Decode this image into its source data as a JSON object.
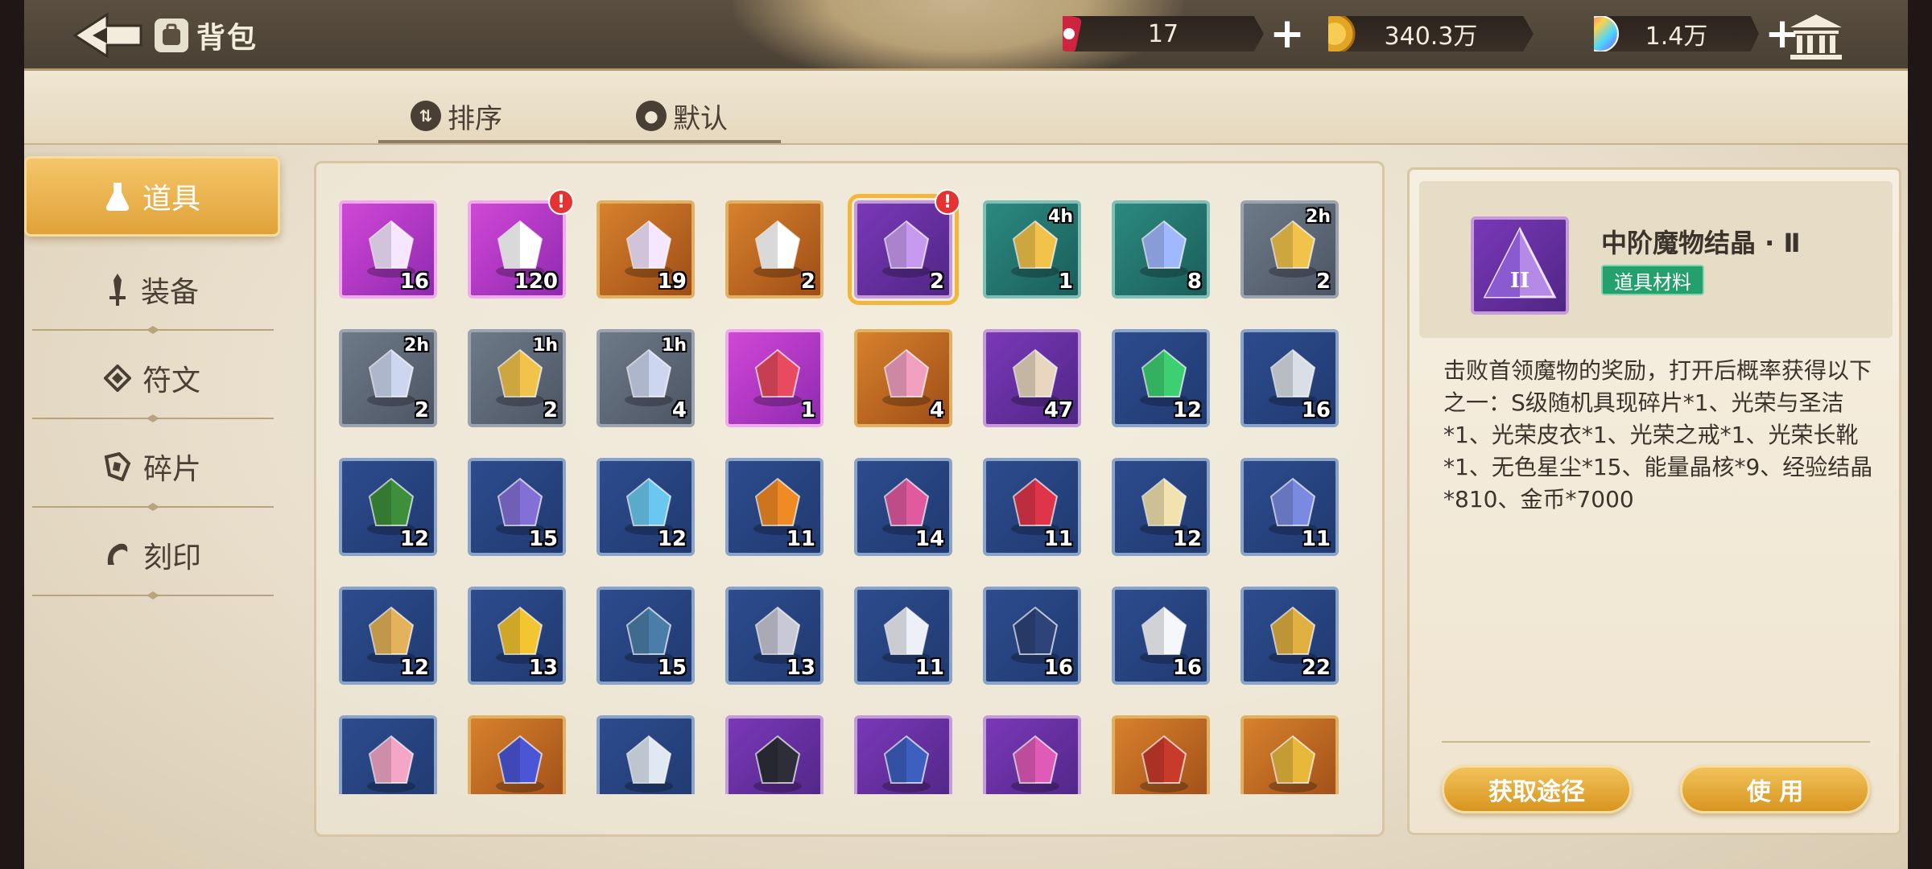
{
  "header": {
    "title": "背包",
    "currencies": [
      {
        "name": "stamina",
        "value": "17",
        "icon": "can-icon",
        "has_plus": true
      },
      {
        "name": "gold",
        "value": "340.3万",
        "icon": "gold-coin-icon",
        "has_plus": false
      },
      {
        "name": "gem",
        "value": "1.4万",
        "icon": "rainbow-gem-icon",
        "has_plus": true
      }
    ]
  },
  "sort": {
    "sort_label": "排序",
    "filter_label": "默认"
  },
  "categories": [
    {
      "label": "道具",
      "icon": "flask-icon",
      "active": true
    },
    {
      "label": "装备",
      "icon": "sword-icon",
      "active": false
    },
    {
      "label": "符文",
      "icon": "rune-icon",
      "active": false
    },
    {
      "label": "碎片",
      "icon": "shard-icon",
      "active": false
    },
    {
      "label": "刻印",
      "icon": "seal-icon",
      "active": false
    }
  ],
  "items": [
    {
      "icon": "mystery-card-icon",
      "rarity": "pink",
      "qty": "16"
    },
    {
      "icon": "character-card-icon",
      "rarity": "pink",
      "qty": "120",
      "alert": true
    },
    {
      "icon": "mystery-card-icon",
      "rarity": "orange",
      "qty": "19"
    },
    {
      "icon": "character-card-icon",
      "rarity": "orange",
      "qty": "2"
    },
    {
      "icon": "purple-crystal-icon",
      "rarity": "purple",
      "qty": "2",
      "alert": true,
      "selected": true
    },
    {
      "icon": "hourglass-coins-icon",
      "rarity": "teal",
      "qty": "1",
      "timer": "4h"
    },
    {
      "icon": "crystal-bowl-icon",
      "rarity": "teal",
      "qty": "8"
    },
    {
      "icon": "hourglass-coins-icon",
      "rarity": "gray",
      "qty": "2",
      "timer": "2h"
    },
    {
      "icon": "hourglass-crystals-icon",
      "rarity": "gray",
      "qty": "2",
      "timer": "2h"
    },
    {
      "icon": "hourglass-coins-icon",
      "rarity": "gray",
      "qty": "2",
      "timer": "1h"
    },
    {
      "icon": "hourglass-crystals-icon",
      "rarity": "gray",
      "qty": "4",
      "timer": "1h"
    },
    {
      "icon": "flower-bouquet-icon",
      "rarity": "pink",
      "qty": "1"
    },
    {
      "icon": "gift-box-icon",
      "rarity": "orange",
      "qty": "4"
    },
    {
      "icon": "robot-pet-icon",
      "rarity": "purple",
      "qty": "47"
    },
    {
      "icon": "green-crystal-icon",
      "rarity": "blue",
      "qty": "12"
    },
    {
      "icon": "white-stone-icon",
      "rarity": "blue",
      "qty": "16"
    },
    {
      "icon": "leaf-icon",
      "rarity": "blue",
      "qty": "12"
    },
    {
      "icon": "purple-rock-icon",
      "rarity": "blue",
      "qty": "15"
    },
    {
      "icon": "water-bowl-icon",
      "rarity": "blue",
      "qty": "12"
    },
    {
      "icon": "orange-potion-icon",
      "rarity": "blue",
      "qty": "11"
    },
    {
      "icon": "pink-potion-icon",
      "rarity": "blue",
      "qty": "14"
    },
    {
      "icon": "red-potion-icon",
      "rarity": "blue",
      "qty": "11"
    },
    {
      "icon": "seed-pile-icon",
      "rarity": "blue",
      "qty": "12"
    },
    {
      "icon": "blue-cloth-icon",
      "rarity": "blue",
      "qty": "11"
    },
    {
      "icon": "potatoes-icon",
      "rarity": "blue",
      "qty": "12"
    },
    {
      "icon": "golden-apple-icon",
      "rarity": "blue",
      "qty": "13"
    },
    {
      "icon": "umbrella-icon",
      "rarity": "blue",
      "qty": "15"
    },
    {
      "icon": "lighter-icon",
      "rarity": "blue",
      "qty": "13"
    },
    {
      "icon": "open-book-icon",
      "rarity": "blue",
      "qty": "11"
    },
    {
      "icon": "closed-book-icon",
      "rarity": "blue",
      "qty": "16"
    },
    {
      "icon": "milk-carton-icon",
      "rarity": "blue",
      "qty": "16"
    },
    {
      "icon": "medal-icon",
      "rarity": "blue",
      "qty": "22"
    },
    {
      "icon": "pink-cushion-icon",
      "rarity": "blue",
      "qty": ""
    },
    {
      "icon": "blue-gem-icon",
      "rarity": "orange",
      "qty": ""
    },
    {
      "icon": "white-crystal-icon",
      "rarity": "blue",
      "qty": ""
    },
    {
      "icon": "dark-blade-icon",
      "rarity": "purple",
      "qty": ""
    },
    {
      "icon": "fashion-tag-icon",
      "rarity": "purple",
      "qty": ""
    },
    {
      "icon": "canned-food-icon",
      "rarity": "purple",
      "qty": ""
    },
    {
      "icon": "dynamite-icon",
      "rarity": "orange",
      "qty": ""
    },
    {
      "icon": "gold-badge-icon",
      "rarity": "orange",
      "qty": ""
    }
  ],
  "detail": {
    "name": "中阶魔物结晶 · Ⅱ",
    "tag": "道具材料",
    "description": "击败首领魔物的奖励，打开后概率获得以下之一：S级随机具现碎片*1、光荣与圣洁*1、光荣皮衣*1、光荣之戒*1、光荣长靴*1、无色星尘*15、能量晶核*9、经验结晶*810、金币*7000",
    "source_button": "获取途径",
    "use_button": "使 用"
  },
  "colors": {
    "accent": "#e0a238",
    "tag_green": "#23a06c",
    "alert_red": "#e53232"
  }
}
